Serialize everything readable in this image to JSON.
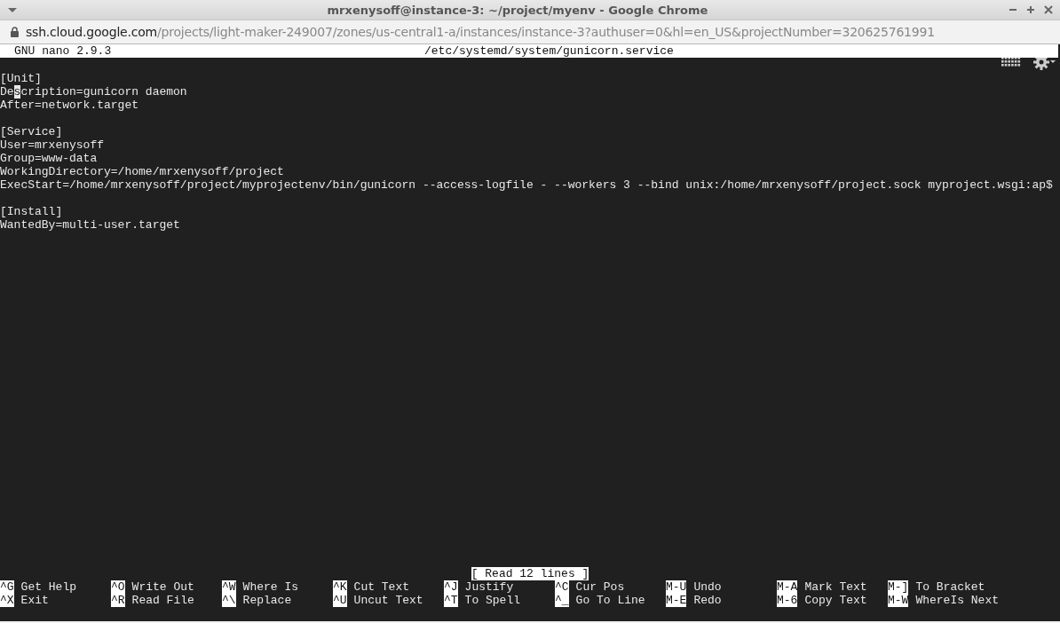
{
  "window": {
    "title": "mrxenysoff@instance-3: ~/project/myenv - Google Chrome"
  },
  "address_bar": {
    "host": "ssh.cloud.google.com",
    "path": "/projects/light-maker-249007/zones/us-central1-a/instances/instance-3?authuser=0&hl=en_US&projectNumber=320625761991"
  },
  "nano": {
    "version": "GNU nano 2.9.3",
    "filename": "/etc/systemd/system/gunicorn.service"
  },
  "sections": [
    {
      "header": "[Unit]",
      "lines": [
        [
          {
            "text": "De",
            "cursor": false
          },
          {
            "text": "s",
            "cursor": true
          },
          {
            "text": "cription=gunicorn daemon",
            "cursor": false
          }
        ],
        [
          {
            "text": "After=network.target",
            "cursor": false
          }
        ]
      ]
    },
    {
      "header": "[Service]",
      "lines": [
        [
          {
            "text": "User=mrxenysoff",
            "cursor": false
          }
        ],
        [
          {
            "text": "Group=www-data",
            "cursor": false
          }
        ],
        [
          {
            "text": "WorkingDirectory=/home/mrxenysoff/project",
            "cursor": false
          }
        ],
        [
          {
            "text": "ExecStart=/home/mrxenysoff/project/myprojectenv/bin/gunicorn --access-logfile - --workers 3 --bind unix:/home/mrxenysoff/project.sock myproject.wsgi:ap$",
            "cursor": false
          }
        ]
      ]
    },
    {
      "header": "[Install]",
      "lines": [
        [
          {
            "text": "WantedBy=multi-user.target",
            "cursor": false
          }
        ]
      ]
    }
  ],
  "status": "[ Read 12 lines ]",
  "shortcuts": [
    [
      {
        "key": "^G",
        "label": "Get Help"
      },
      {
        "key": "^O",
        "label": "Write Out"
      },
      {
        "key": "^W",
        "label": "Where Is"
      },
      {
        "key": "^K",
        "label": "Cut Text"
      },
      {
        "key": "^J",
        "label": "Justify"
      },
      {
        "key": "^C",
        "label": "Cur Pos"
      },
      {
        "key": "M-U",
        "label": "Undo"
      },
      {
        "key": "M-A",
        "label": "Mark Text"
      },
      {
        "key": "M-]",
        "label": "To Bracket"
      }
    ],
    [
      {
        "key": "^X",
        "label": "Exit"
      },
      {
        "key": "^R",
        "label": "Read File"
      },
      {
        "key": "^\\",
        "label": "Replace"
      },
      {
        "key": "^U",
        "label": "Uncut Text"
      },
      {
        "key": "^T",
        "label": "To Spell"
      },
      {
        "key": "^_",
        "label": "Go To Line"
      },
      {
        "key": "M-E",
        "label": "Redo"
      },
      {
        "key": "M-6",
        "label": "Copy Text"
      },
      {
        "key": "M-W",
        "label": "WhereIs Next"
      }
    ]
  ]
}
